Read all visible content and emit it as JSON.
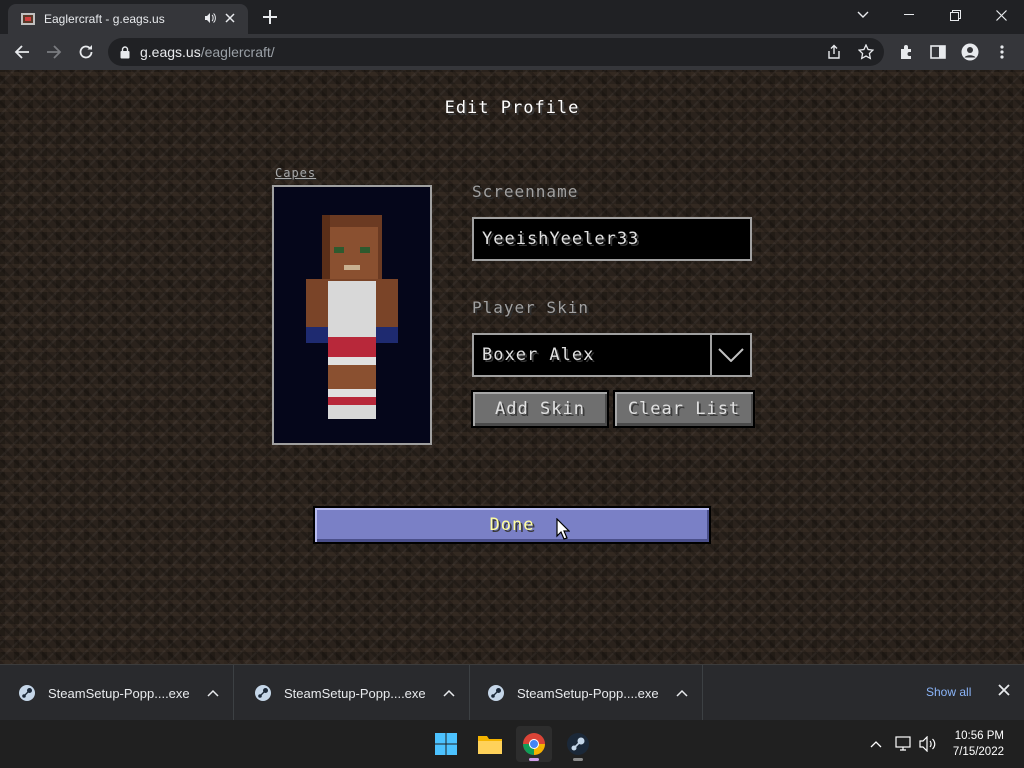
{
  "browser": {
    "tab_title": "Eaglercraft - g.eags.us",
    "url_host": "g.eags.us",
    "url_path": "/eaglercraft/"
  },
  "profile": {
    "title": "Edit Profile",
    "capes_link": "Capes",
    "screenname_label": "Screenname",
    "screenname_value": "YeeishYeeler33",
    "skin_label": "Player Skin",
    "skin_value": "Boxer Alex",
    "add_skin_label": "Add Skin",
    "clear_list_label": "Clear List",
    "done_label": "Done"
  },
  "downloads": {
    "items": [
      {
        "name": "SteamSetup-Popp....exe"
      },
      {
        "name": "SteamSetup-Popp....exe"
      },
      {
        "name": "SteamSetup-Popp....exe"
      }
    ],
    "show_all_label": "Show all"
  },
  "taskbar": {
    "time": "10:56 PM",
    "date": "7/15/2022"
  },
  "colors": {
    "done_button": "#7a80c6",
    "chrome_bg": "#202124",
    "toolbar_bg": "#35363a"
  }
}
